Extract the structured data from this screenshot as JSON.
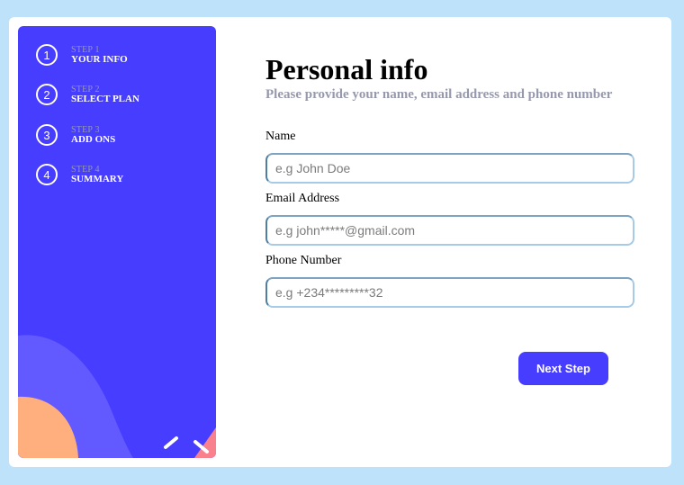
{
  "sidebar": {
    "steps": [
      {
        "number": "1",
        "label": "STEP 1",
        "title": "YOUR INFO"
      },
      {
        "number": "2",
        "label": "STEP 2",
        "title": "SELECT PLAN"
      },
      {
        "number": "3",
        "label": "STEP 3",
        "title": "ADD ONS"
      },
      {
        "number": "4",
        "label": "STEP 4",
        "title": "SUMMARY"
      }
    ]
  },
  "main": {
    "title": "Personal info",
    "subtitle": "Please provide your name, email address and phone number",
    "fields": {
      "name": {
        "label": "Name",
        "value": "",
        "placeholder": "e.g John Doe"
      },
      "email": {
        "label": "Email Address",
        "value": "",
        "placeholder": "e.g john*****@gmail.com"
      },
      "phone": {
        "label": "Phone Number",
        "value": "",
        "placeholder": "e.g +234*********32"
      }
    },
    "next_label": "Next Step"
  },
  "colors": {
    "page_background": "#bfe2fb",
    "sidebar": "#473dff",
    "accent": "#473dff",
    "muted_text": "#9699ab",
    "wave": "#6259ff",
    "orange_blob": "#ffaf7e",
    "pink_blob": "#f9818e"
  }
}
